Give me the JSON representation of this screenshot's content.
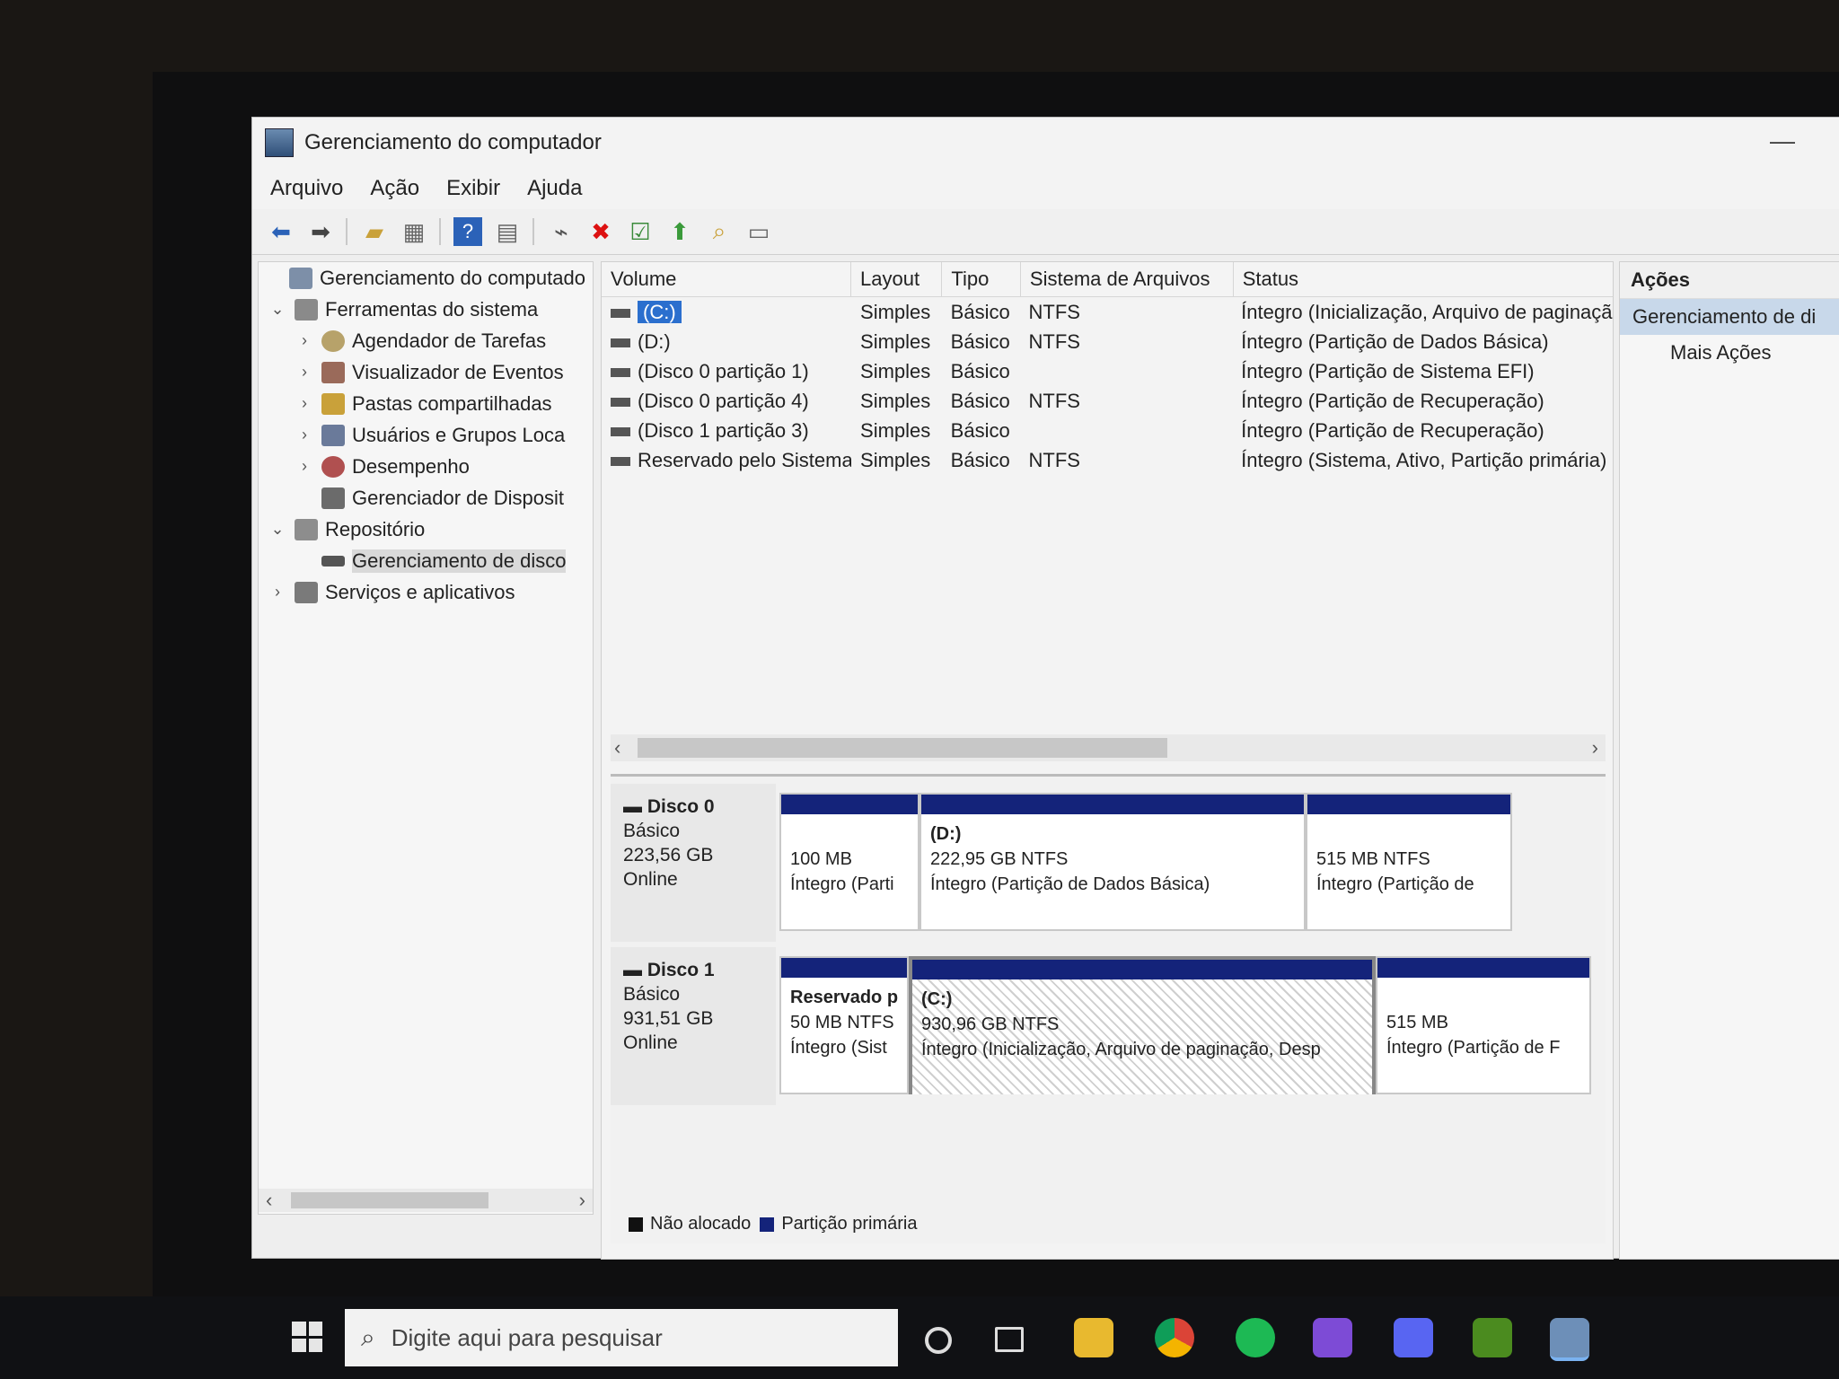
{
  "window": {
    "title": "Gerenciamento do computador",
    "minimize": "—"
  },
  "menu": [
    "Arquivo",
    "Ação",
    "Exibir",
    "Ajuda"
  ],
  "toolbar_icons": [
    "back-icon",
    "forward-icon",
    "up-folder-icon",
    "console-tree-icon",
    "help-icon",
    "show-hide-icon",
    "connect-icon",
    "delete-icon",
    "properties-icon",
    "export-icon",
    "search-icon",
    "view-icon"
  ],
  "tree": {
    "items": [
      {
        "label": "Gerenciamento do computado",
        "level": 0,
        "chevron": ""
      },
      {
        "label": "Ferramentas do sistema",
        "level": 1,
        "chevron": "⌄"
      },
      {
        "label": "Agendador de Tarefas",
        "level": 2,
        "chevron": "›"
      },
      {
        "label": "Visualizador de Eventos",
        "level": 2,
        "chevron": "›"
      },
      {
        "label": "Pastas compartilhadas",
        "level": 2,
        "chevron": "›"
      },
      {
        "label": "Usuários e Grupos Loca",
        "level": 2,
        "chevron": "›"
      },
      {
        "label": "Desempenho",
        "level": 2,
        "chevron": "›"
      },
      {
        "label": "Gerenciador de Disposit",
        "level": 2,
        "chevron": ""
      },
      {
        "label": "Repositório",
        "level": 1,
        "chevron": "⌄"
      },
      {
        "label": "Gerenciamento de disco",
        "level": 2,
        "chevron": ""
      },
      {
        "label": "Serviços e aplicativos",
        "level": 1,
        "chevron": "›"
      }
    ],
    "scroll_left": "‹",
    "scroll_right": "›"
  },
  "volumes": {
    "headers": [
      "Volume",
      "Layout",
      "Tipo",
      "Sistema de Arquivos",
      "Status"
    ],
    "rows": [
      {
        "volume": "(C:)",
        "layout": "Simples",
        "tipo": "Básico",
        "fs": "NTFS",
        "status": "Íntegro (Inicialização, Arquivo de paginaçã"
      },
      {
        "volume": "(D:)",
        "layout": "Simples",
        "tipo": "Básico",
        "fs": "NTFS",
        "status": "Íntegro (Partição de Dados Básica)"
      },
      {
        "volume": "(Disco 0 partição 1)",
        "layout": "Simples",
        "tipo": "Básico",
        "fs": "",
        "status": "Íntegro (Partição de Sistema EFI)"
      },
      {
        "volume": "(Disco 0 partição 4)",
        "layout": "Simples",
        "tipo": "Básico",
        "fs": "NTFS",
        "status": "Íntegro (Partição de Recuperação)"
      },
      {
        "volume": "(Disco 1 partição 3)",
        "layout": "Simples",
        "tipo": "Básico",
        "fs": "",
        "status": "Íntegro (Partição de Recuperação)"
      },
      {
        "volume": "Reservado pelo Sistema",
        "layout": "Simples",
        "tipo": "Básico",
        "fs": "NTFS",
        "status": "Íntegro (Sistema, Ativo, Partição primária)"
      }
    ],
    "scroll_left": "‹",
    "scroll_right": "›"
  },
  "disks": [
    {
      "name": "Disco 0",
      "type": "Básico",
      "size": "223,56 GB",
      "state": "Online",
      "partitions": [
        {
          "title": "",
          "line1": "100 MB",
          "line2": "Íntegro (Parti"
        },
        {
          "title": "(D:)",
          "line1": "222,95 GB NTFS",
          "line2": "Íntegro (Partição de Dados Básica)"
        },
        {
          "title": "",
          "line1": "515 MB NTFS",
          "line2": "Íntegro (Partição de"
        }
      ]
    },
    {
      "name": "Disco 1",
      "type": "Básico",
      "size": "931,51 GB",
      "state": "Online",
      "partitions": [
        {
          "title": "Reservado p",
          "line1": "50 MB NTFS",
          "line2": "Íntegro (Sist"
        },
        {
          "title": "(C:)",
          "line1": "930,96 GB NTFS",
          "line2": "Íntegro (Inicialização, Arquivo de paginação, Desp"
        },
        {
          "title": "",
          "line1": "515 MB",
          "line2": "Íntegro (Partição de F"
        }
      ]
    }
  ],
  "legend": [
    {
      "label": "Não alocado",
      "color": "#111111"
    },
    {
      "label": "Partição primária",
      "color": "#14237a"
    }
  ],
  "actions": {
    "header": "Ações",
    "main": "Gerenciamento de di",
    "more": "Mais Ações"
  },
  "taskbar": {
    "search_placeholder": "Digite aqui para pesquisar"
  }
}
